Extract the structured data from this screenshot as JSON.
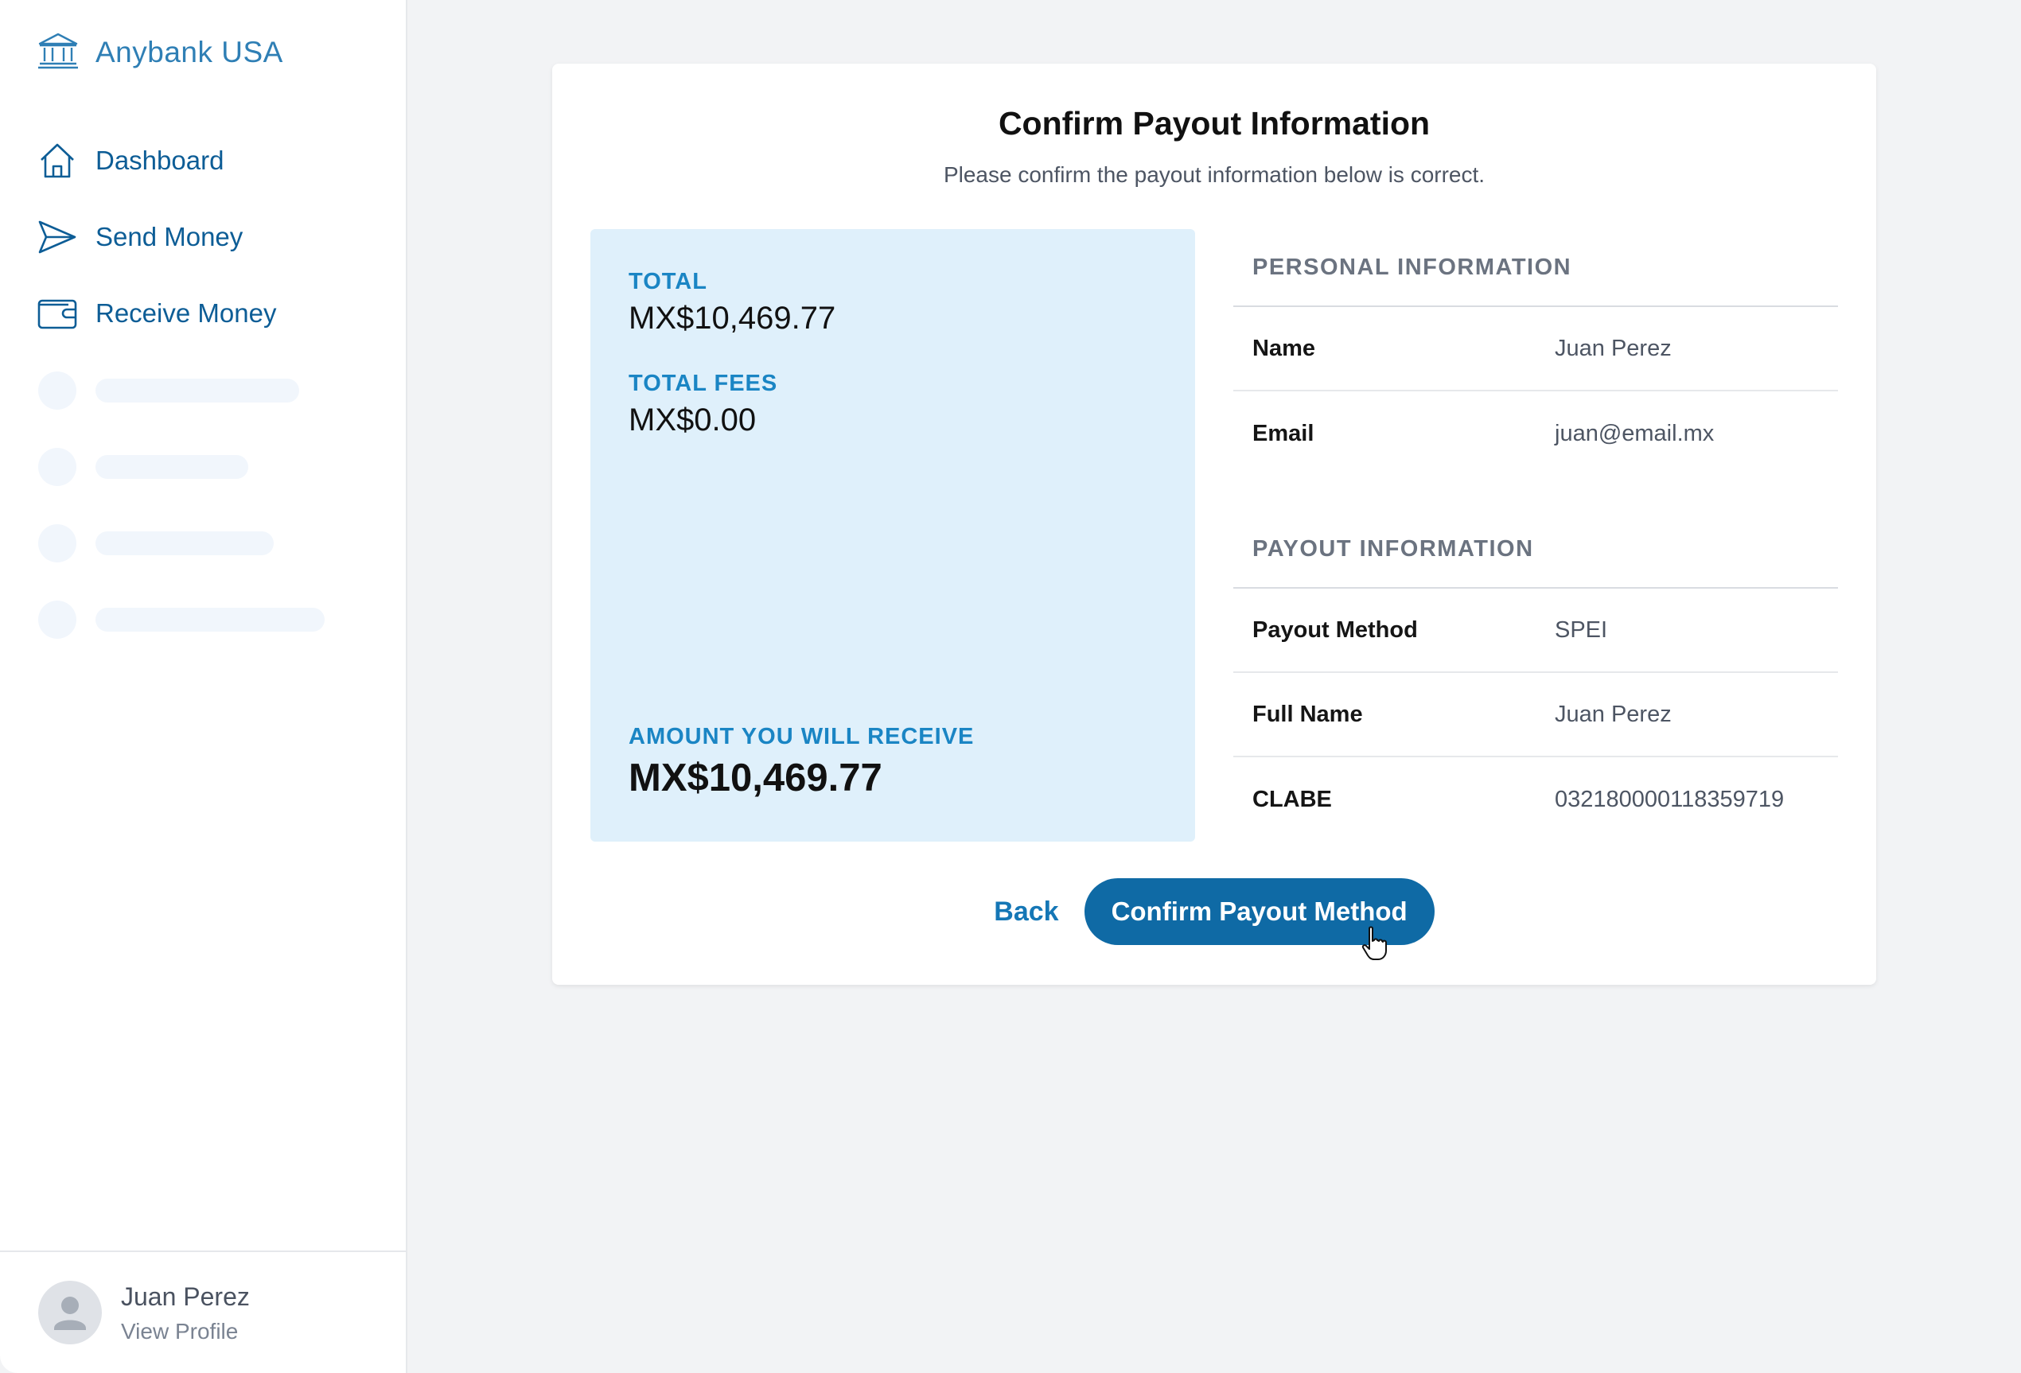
{
  "brand": {
    "name": "Anybank USA",
    "icon": "bank-icon"
  },
  "sidebar": {
    "items": [
      {
        "label": "Dashboard",
        "icon": "home-icon"
      },
      {
        "label": "Send Money",
        "icon": "send-icon"
      },
      {
        "label": "Receive Money",
        "icon": "wallet-icon"
      }
    ],
    "profile": {
      "name": "Juan Perez",
      "link": "View Profile",
      "icon": "user-icon"
    }
  },
  "main": {
    "title": "Confirm Payout Information",
    "subtitle": "Please confirm the payout information below is correct.",
    "summary": {
      "total_label": "TOTAL",
      "total_value": "MX$10,469.77",
      "fees_label": "TOTAL FEES",
      "fees_value": "MX$0.00",
      "receive_label": "AMOUNT YOU WILL RECEIVE",
      "receive_value": "MX$10,469.77"
    },
    "personal": {
      "heading": "PERSONAL INFORMATION",
      "rows": [
        {
          "label": "Name",
          "value": "Juan Perez"
        },
        {
          "label": "Email",
          "value": "juan@email.mx"
        }
      ]
    },
    "payout": {
      "heading": "PAYOUT INFORMATION",
      "rows": [
        {
          "label": "Payout Method",
          "value": "SPEI"
        },
        {
          "label": "Full Name",
          "value": "Juan Perez"
        },
        {
          "label": "CLABE",
          "value": "032180000118359719"
        }
      ]
    },
    "actions": {
      "back": "Back",
      "confirm": "Confirm Payout Method"
    }
  },
  "colors": {
    "accent": "#0f6aa5",
    "nav_text": "#0d5d96",
    "summary_bg": "#dff0fb",
    "summary_label": "#1a85c4",
    "page_bg": "#f2f3f5"
  }
}
